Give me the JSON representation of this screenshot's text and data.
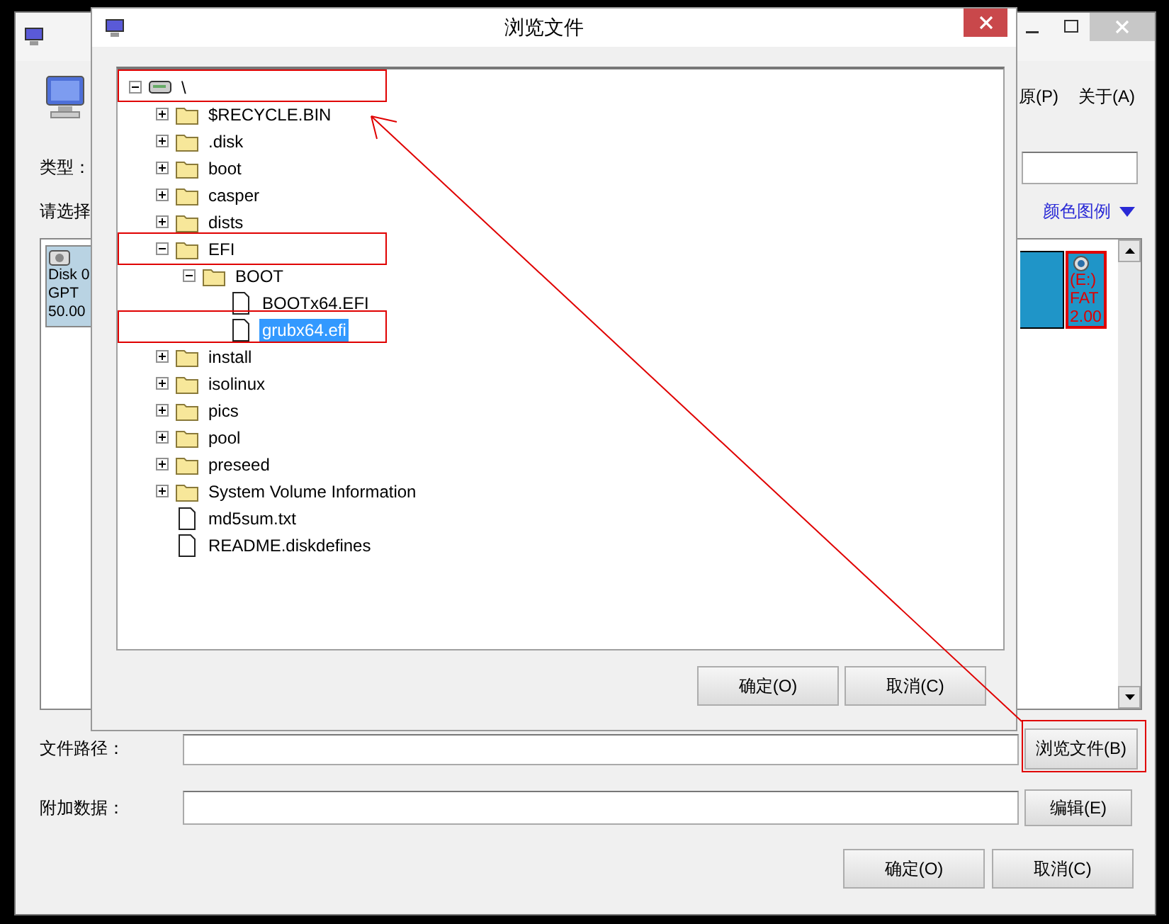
{
  "main_window": {
    "menus": [
      "原(P)",
      "关于(A)"
    ],
    "type_label": "类型：",
    "select_label": "请选择",
    "legend_link": "颜色图例",
    "disk": {
      "lines": [
        "Disk 0",
        "GPT",
        "50.00"
      ]
    },
    "partition": {
      "lines": [
        "(E:)",
        "FAT",
        "2.00"
      ],
      "selected": true
    },
    "file_path_label": "文件路径：",
    "browse_button": "浏览文件(B)",
    "extra_data_label": "附加数据：",
    "edit_button": "编辑(E)",
    "buttons": [
      "确定(O)",
      "取消(C)"
    ]
  },
  "dialog": {
    "title": "浏览文件",
    "tree": [
      {
        "label": "\\",
        "kind": "drive",
        "expanded": true,
        "selected": false,
        "children": [
          {
            "label": "$RECYCLE.BIN",
            "kind": "folder",
            "expanded": false,
            "selected": false
          },
          {
            "label": ".disk",
            "kind": "folder",
            "expanded": false,
            "selected": false
          },
          {
            "label": "boot",
            "kind": "folder",
            "expanded": false,
            "selected": false
          },
          {
            "label": "casper",
            "kind": "folder",
            "expanded": false,
            "selected": false
          },
          {
            "label": "dists",
            "kind": "folder",
            "expanded": false,
            "selected": false
          },
          {
            "label": "EFI",
            "kind": "folder",
            "expanded": true,
            "selected": false,
            "children": [
              {
                "label": "BOOT",
                "kind": "folder",
                "expanded": true,
                "selected": false,
                "children": [
                  {
                    "label": "BOOTx64.EFI",
                    "kind": "file",
                    "selected": false
                  },
                  {
                    "label": "grubx64.efi",
                    "kind": "file",
                    "selected": true
                  }
                ]
              }
            ]
          },
          {
            "label": "install",
            "kind": "folder",
            "expanded": false,
            "selected": false
          },
          {
            "label": "isolinux",
            "kind": "folder",
            "expanded": false,
            "selected": false
          },
          {
            "label": "pics",
            "kind": "folder",
            "expanded": false,
            "selected": false
          },
          {
            "label": "pool",
            "kind": "folder",
            "expanded": false,
            "selected": false
          },
          {
            "label": "preseed",
            "kind": "folder",
            "expanded": false,
            "selected": false
          },
          {
            "label": "System Volume Information",
            "kind": "folder",
            "expanded": false,
            "selected": false
          },
          {
            "label": "md5sum.txt",
            "kind": "file",
            "selected": false
          },
          {
            "label": "README.diskdefines",
            "kind": "file",
            "selected": false
          }
        ]
      }
    ],
    "buttons": [
      "确定(O)",
      "取消(C)"
    ]
  }
}
